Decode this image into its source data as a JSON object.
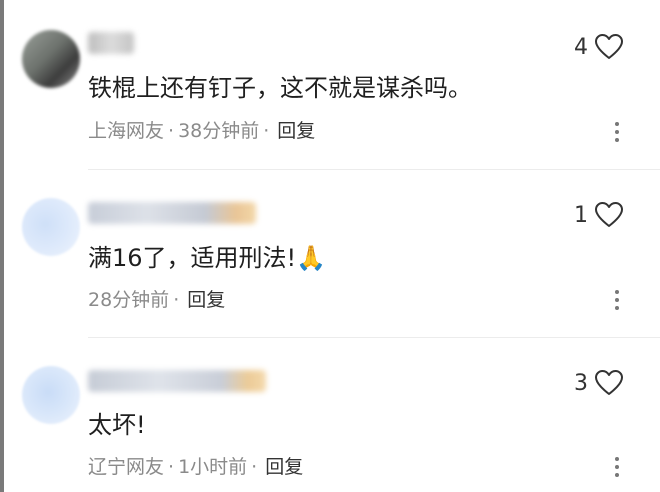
{
  "comments": [
    {
      "text": "铁棍上还有钉子，这不就是谋杀吗。",
      "location": "上海网友",
      "time": "38分钟前",
      "reply_label": "回复",
      "likes": "4"
    },
    {
      "text": "满16了，适用刑法!",
      "emoji": "🙏",
      "location": "",
      "time": "28分钟前",
      "reply_label": "回复",
      "likes": "1"
    },
    {
      "text": "太坏!",
      "location": "辽宁网友",
      "time": "1小时前",
      "reply_label": "回复",
      "likes": "3"
    }
  ],
  "separator": "·",
  "icons": {
    "like": "heart-outline-icon",
    "more": "vertical-dots-icon"
  },
  "colors": {
    "text": "#1f1f1f",
    "meta": "#8a8a8a",
    "reply": "#333333"
  }
}
